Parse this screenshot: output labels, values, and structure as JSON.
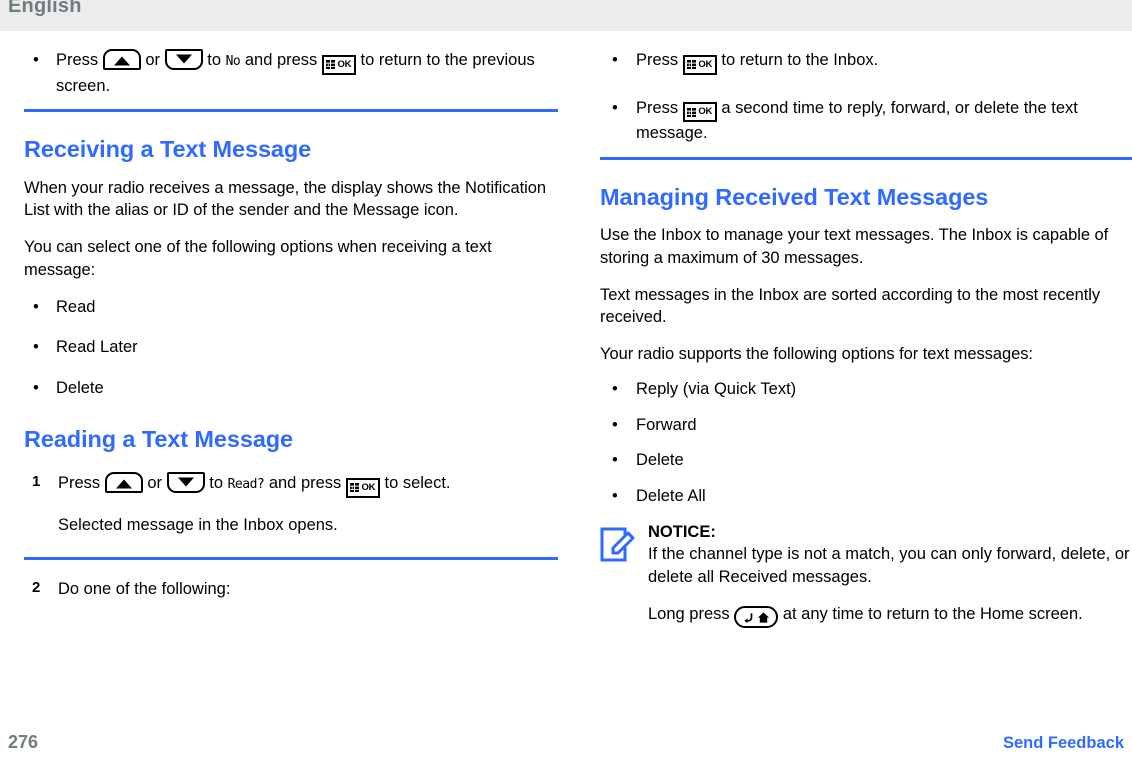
{
  "header": {
    "language_label": "English"
  },
  "left_column": {
    "top_bullets": [
      {
        "segments": [
          {
            "type": "text",
            "value": "Press "
          },
          {
            "type": "icon",
            "value": "nav-up-key"
          },
          {
            "type": "text",
            "value": " or "
          },
          {
            "type": "icon",
            "value": "nav-down-key"
          },
          {
            "type": "text",
            "value": " to "
          },
          {
            "type": "lcd",
            "value": "No"
          },
          {
            "type": "text",
            "value": " and press "
          },
          {
            "type": "icon",
            "value": "ok-key"
          },
          {
            "type": "text",
            "value": " to return to the previous screen."
          }
        ],
        "part_a": "Press",
        "part_b": "or",
        "part_c": "to",
        "lcd_value": "No",
        "part_d": "and press",
        "part_e": "to return to the previous screen."
      }
    ],
    "section_receiving": {
      "heading": "Receiving a Text Message",
      "paragraph_1": "When your radio receives a message, the display shows the Notification List with the alias or ID of the sender and the Message icon.",
      "paragraph_2": "You can select one of the following options when receiving a text message:",
      "options": [
        "Read",
        "Read Later",
        "Delete"
      ]
    },
    "section_reading": {
      "heading": "Reading a Text Message",
      "step_1": {
        "number": "1",
        "part_a": "Press",
        "part_b": "or",
        "part_c": "to",
        "lcd_value": "Read?",
        "part_d": "and press",
        "part_e": "to select.",
        "result": "Selected message in the Inbox opens."
      },
      "step_2": {
        "number": "2",
        "text": "Do one of the following:"
      }
    }
  },
  "right_column": {
    "top_bullets": [
      {
        "part_a": "Press",
        "part_b": "to return to the Inbox."
      },
      {
        "part_a": "Press",
        "part_b": "a second time to reply, forward, or delete the text message."
      }
    ],
    "section_managing": {
      "heading": "Managing Received Text Messages",
      "paragraph_1": "Use the Inbox to manage your text messages. The Inbox is capable of storing a maximum of 30 messages.",
      "paragraph_2": "Text messages in the Inbox are sorted according to the most recently received.",
      "paragraph_3": "Your radio supports the following options for text messages:",
      "options": [
        "Reply (via Quick Text)",
        "Forward",
        "Delete",
        "Delete All"
      ],
      "notice": {
        "title": "NOTICE:",
        "body": "If the channel type is not a match, you can only forward, delete, or delete all Received messages.",
        "long_press_a": "Long press",
        "long_press_b": "at any time to return to the Home screen."
      }
    }
  },
  "footer": {
    "page_number": "276",
    "feedback_link": "Send Feedback"
  },
  "icons": {
    "nav_up": "nav-up-key",
    "nav_down": "nav-down-key",
    "ok": "ok-key",
    "back_home": "back-home-key",
    "notice": "notice-pencil-icon"
  },
  "colors": {
    "accent_blue": "#2f6bff",
    "header_gray": "#ececec",
    "header_text": "#6d7d80",
    "body_text": "#000000"
  },
  "bullet_glyph": "•"
}
